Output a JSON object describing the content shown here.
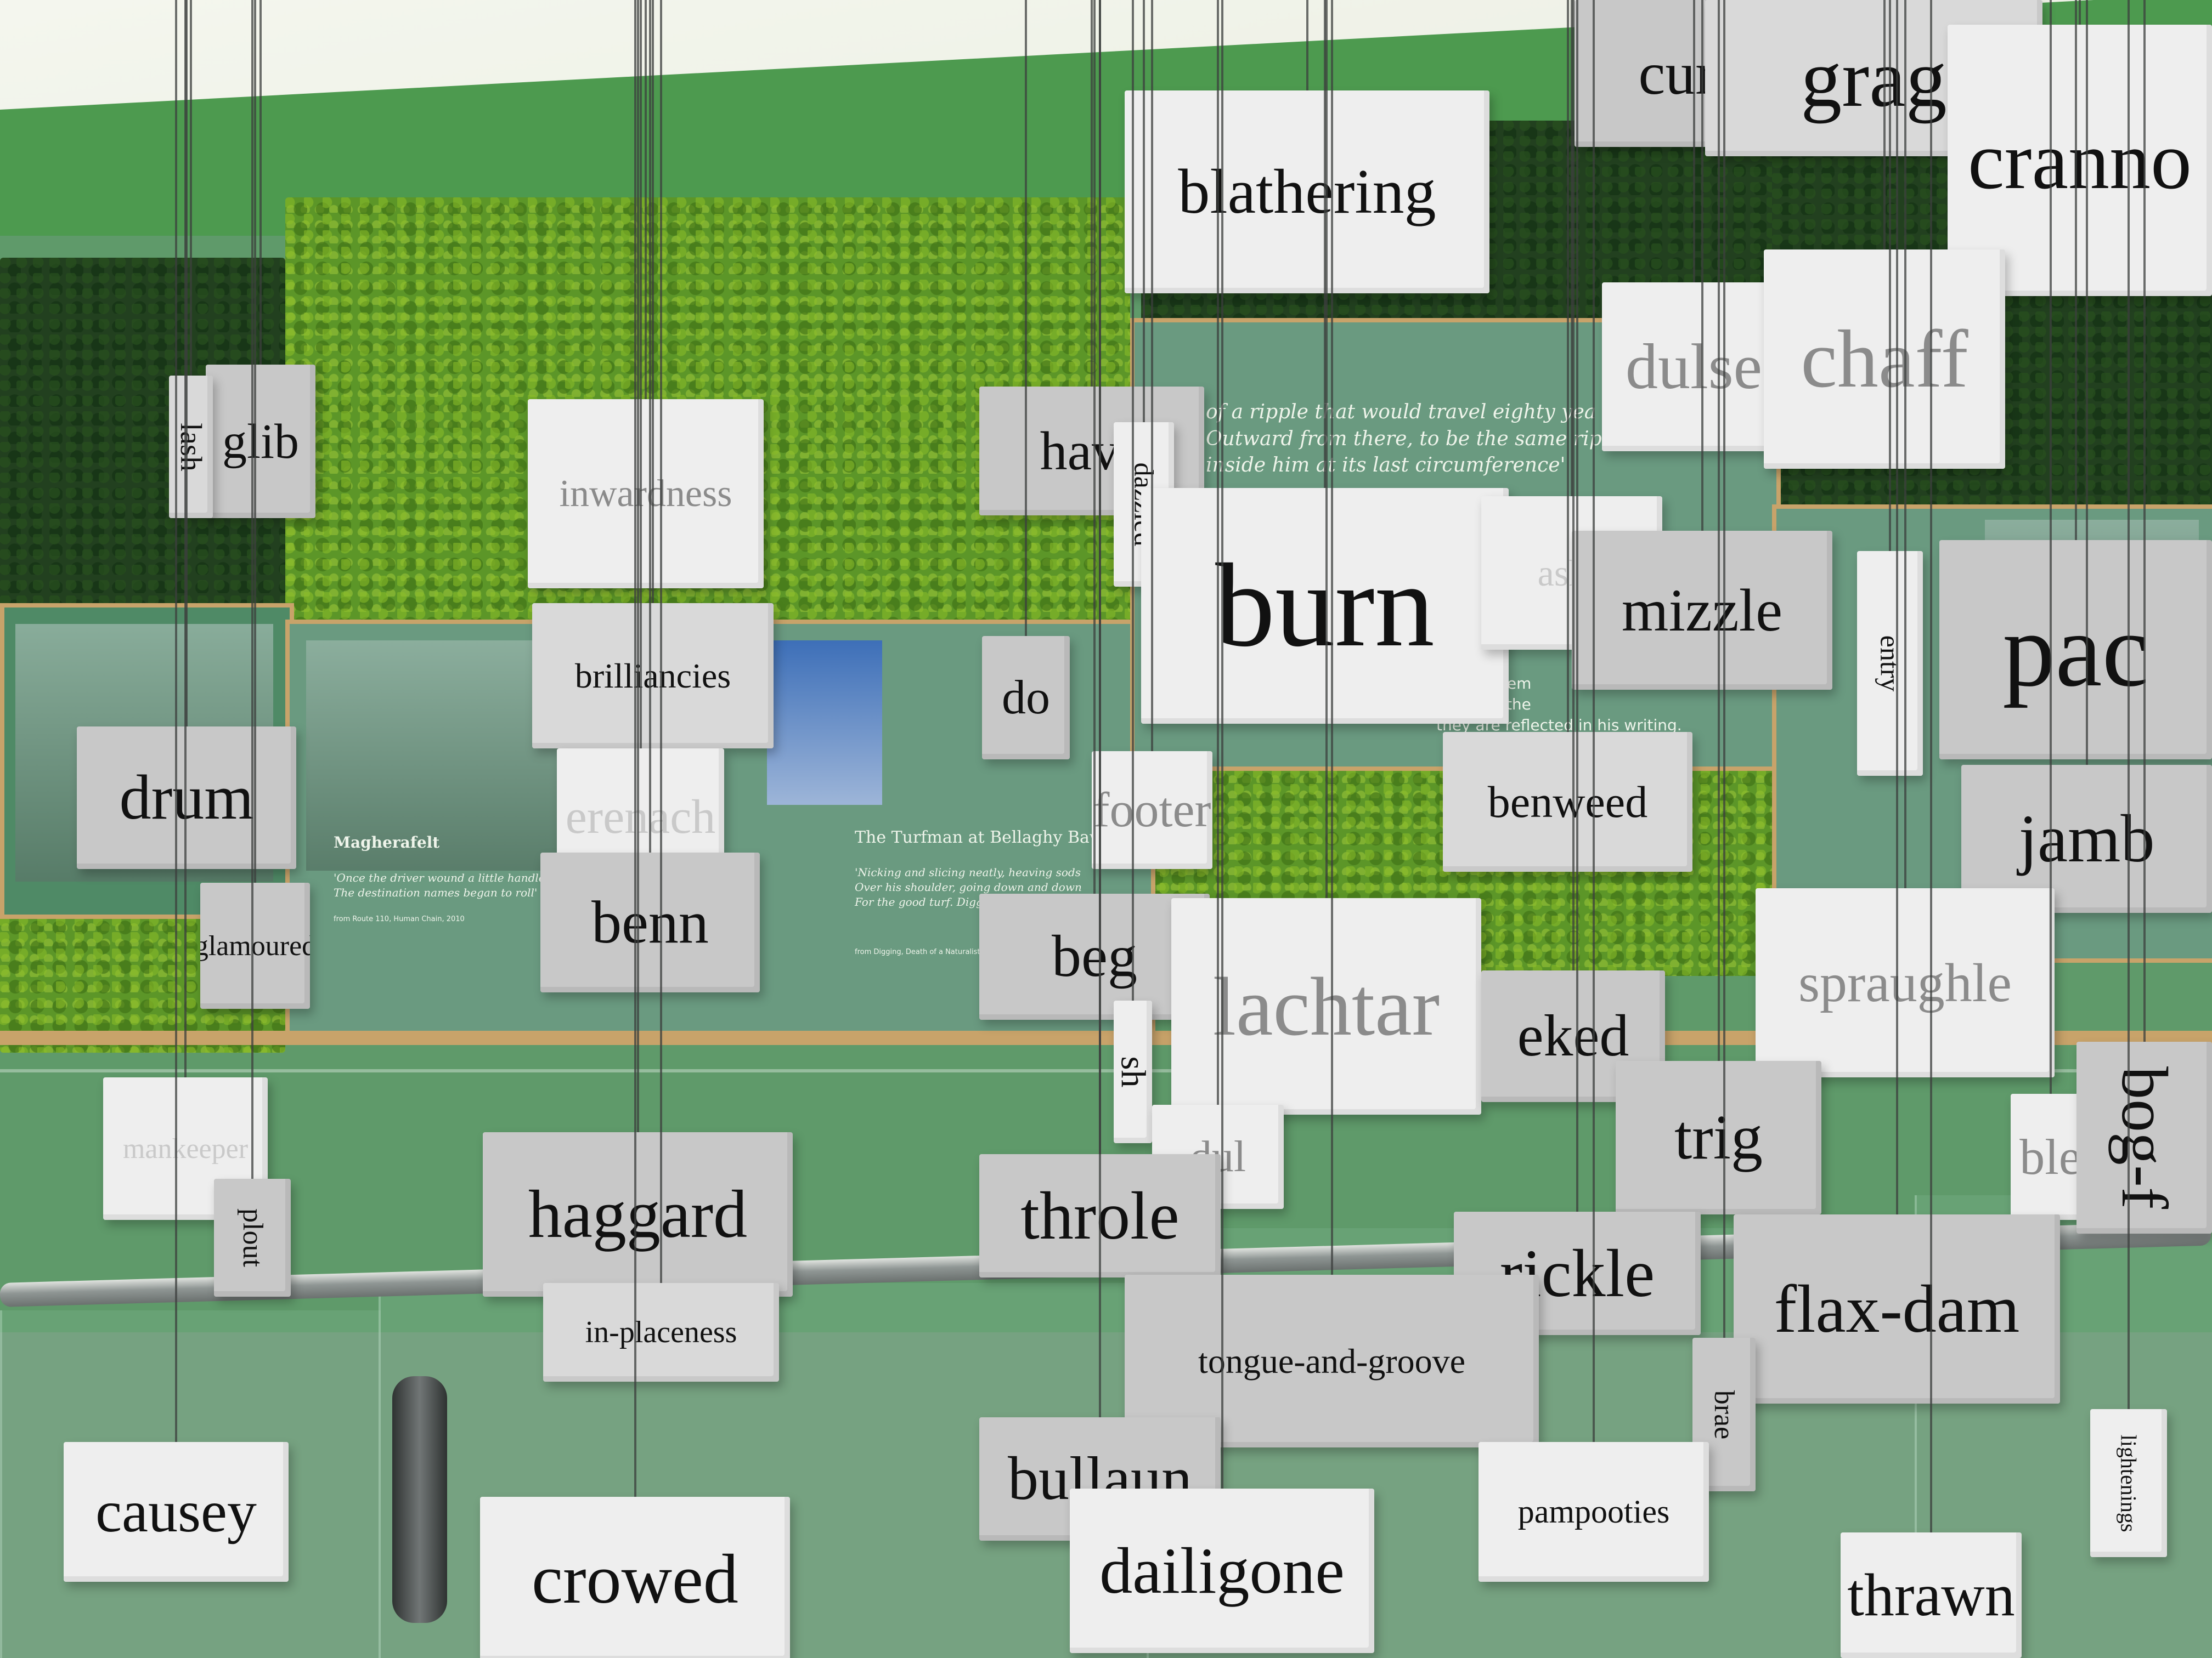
{
  "words": [
    {
      "text": "glib"
    },
    {
      "text": "lash"
    },
    {
      "text": "inwardness"
    },
    {
      "text": "brilliancies"
    },
    {
      "text": "erenach"
    },
    {
      "text": "benn"
    },
    {
      "text": "drum"
    },
    {
      "text": "glamoured"
    },
    {
      "text": "mankeeper"
    },
    {
      "text": "plout"
    },
    {
      "text": "haggard"
    },
    {
      "text": "in-placeness"
    },
    {
      "text": "causey"
    },
    {
      "text": "crowed"
    },
    {
      "text": "blathering"
    },
    {
      "text": "curr"
    },
    {
      "text": "grag"
    },
    {
      "text": "cranno"
    },
    {
      "text": "dulse"
    },
    {
      "text": "chaff"
    },
    {
      "text": "have"
    },
    {
      "text": "dazzled"
    },
    {
      "text": "burn"
    },
    {
      "text": "ashp"
    },
    {
      "text": "mizzle"
    },
    {
      "text": "entry"
    },
    {
      "text": "pac"
    },
    {
      "text": "do"
    },
    {
      "text": "footer"
    },
    {
      "text": "benweed"
    },
    {
      "text": "jamb"
    },
    {
      "text": "beg"
    },
    {
      "text": "lachtar"
    },
    {
      "text": "eked"
    },
    {
      "text": "spraughle"
    },
    {
      "text": "sh"
    },
    {
      "text": "dul"
    },
    {
      "text": "trig"
    },
    {
      "text": "ble"
    },
    {
      "text": "bog-f"
    },
    {
      "text": "throle"
    },
    {
      "text": "rickle"
    },
    {
      "text": "flax-dam"
    },
    {
      "text": "tongue-and-groove"
    },
    {
      "text": "brae"
    },
    {
      "text": "lightenings"
    },
    {
      "text": "bullaun"
    },
    {
      "text": "pampooties"
    },
    {
      "text": "dailigone"
    },
    {
      "text": "thrawn"
    }
  ],
  "wall": {
    "caption_magherafelt": "Magherafelt",
    "quote_magherafelt": "'Once the driver wound a little handle\nThe destination names began to roll'",
    "source_magherafelt": "from Route 110, Human Chain, 2010",
    "caption_turfman": "The Turfman at Bellaghy Bawn",
    "quote_turfman": "'Nicking and slicing neatly, heaving sods\nOver his shoulder, going down and down\nFor the good turf. Digging'",
    "source_turfman": "from Digging, Death of a Naturalist, 1966",
    "quote_ripple": "of a ripple that would travel eighty yea\nOutward from there, to be the same rippl\ninside him at its last circumference'",
    "text_reflected": "of them rem\nyou visit the\nthey are reflected in his writing."
  }
}
